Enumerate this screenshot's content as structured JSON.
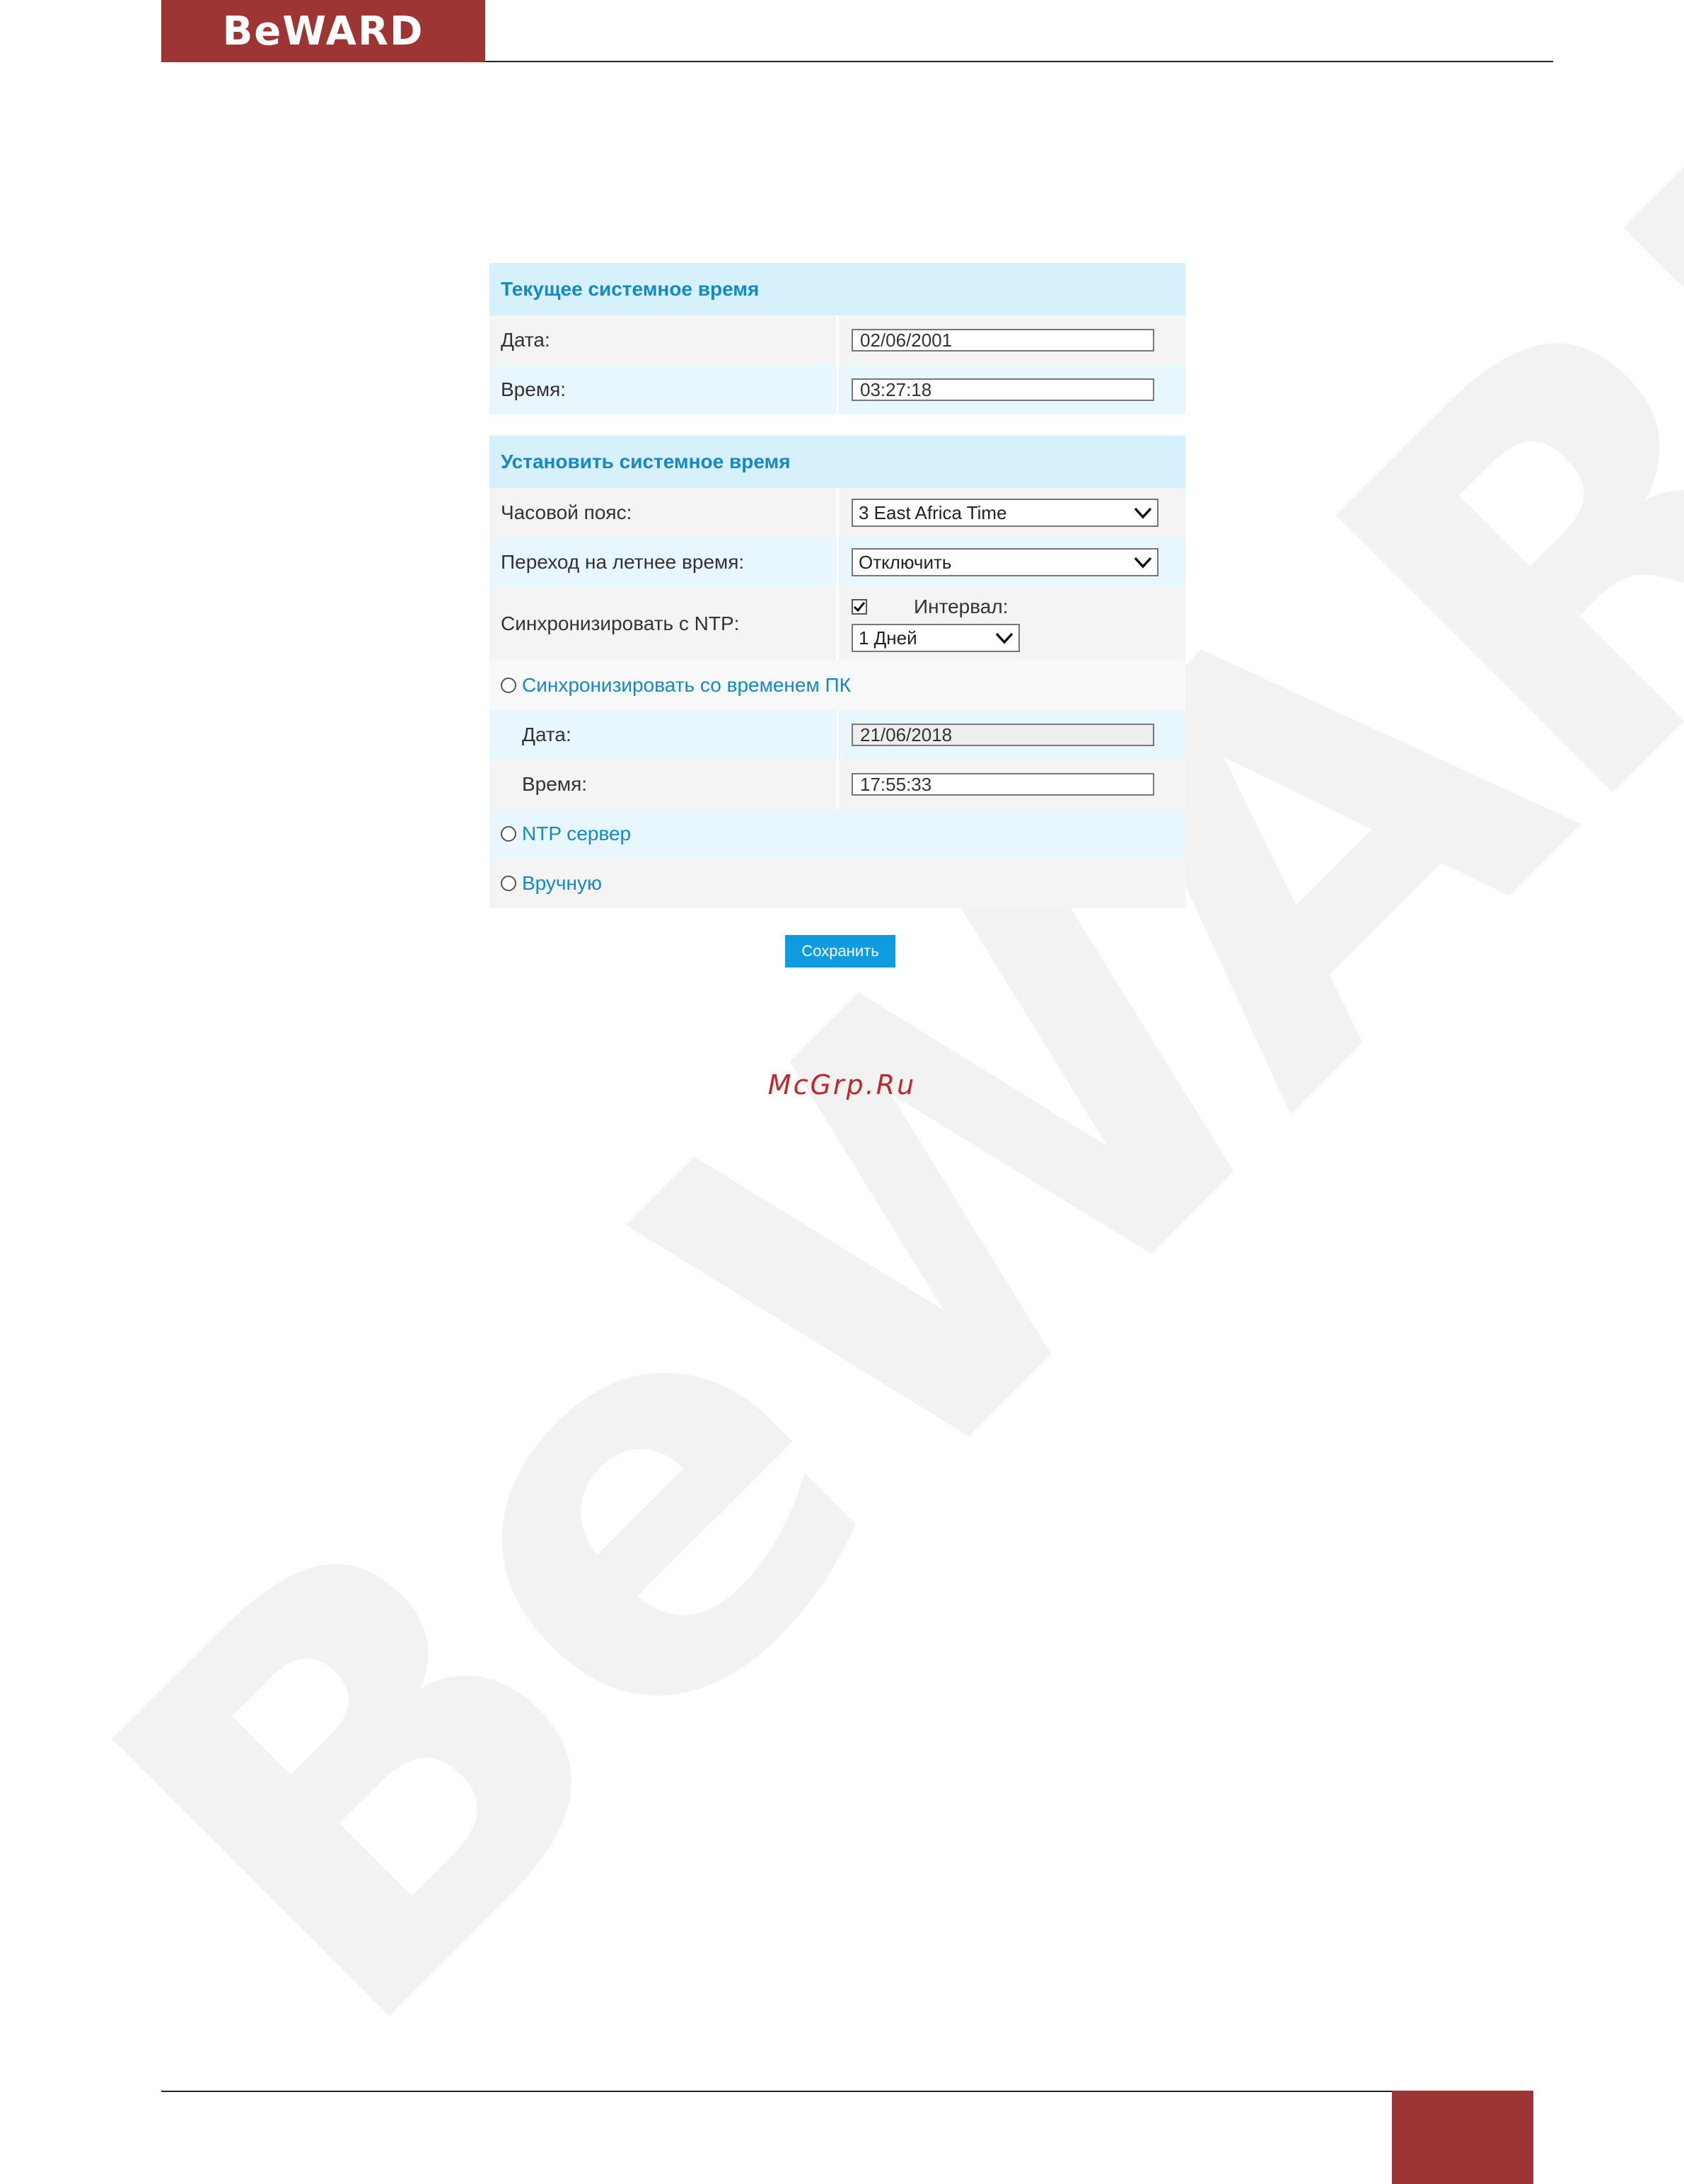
{
  "header": {
    "logo": "BeWARD"
  },
  "watermark": {
    "text": "BeWARD"
  },
  "current_time": {
    "title": "Текущее системное время",
    "date_label": "Дата:",
    "date_value": "02/06/2001",
    "time_label": "Время:",
    "time_value": "03:27:18"
  },
  "set_time": {
    "title": "Установить системное время",
    "timezone_label": "Часовой пояс:",
    "timezone_value": "3 East Africa Time",
    "dst_label": "Переход на летнее время:",
    "dst_value": "Отключить",
    "ntp_sync_label": "Синхронизировать с NTP:",
    "ntp_sync_checked": true,
    "interval_label": "Интервал:",
    "interval_value": "1 Дней",
    "pc_sync_label": "Синхронизировать со временем ПК",
    "pc_date_label": "Дата:",
    "pc_date_value": "21/06/2018",
    "pc_time_label": "Время:",
    "pc_time_value": "17:55:33",
    "ntp_server_label": "NTP сервер",
    "manual_label": "Вручную"
  },
  "save_label": "Сохранить",
  "site_mark": "McGrp.Ru",
  "colors": {
    "brand": "#9e3535",
    "accent": "#1489c4",
    "button": "#0f9be0",
    "section_bg": "#d6f1fb"
  }
}
